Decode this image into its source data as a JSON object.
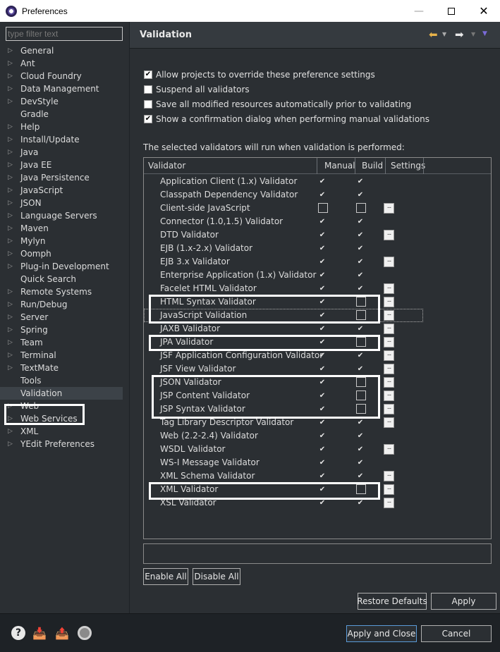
{
  "window": {
    "title": "Preferences"
  },
  "filter": {
    "placeholder": "type filter text"
  },
  "tree": [
    {
      "label": "General",
      "arrow": true
    },
    {
      "label": "Ant",
      "arrow": true
    },
    {
      "label": "Cloud Foundry",
      "arrow": true
    },
    {
      "label": "Data Management",
      "arrow": true
    },
    {
      "label": "DevStyle",
      "arrow": true
    },
    {
      "label": "Gradle",
      "arrow": false
    },
    {
      "label": "Help",
      "arrow": true
    },
    {
      "label": "Install/Update",
      "arrow": true
    },
    {
      "label": "Java",
      "arrow": true
    },
    {
      "label": "Java EE",
      "arrow": true
    },
    {
      "label": "Java Persistence",
      "arrow": true
    },
    {
      "label": "JavaScript",
      "arrow": true
    },
    {
      "label": "JSON",
      "arrow": true
    },
    {
      "label": "Language Servers",
      "arrow": true
    },
    {
      "label": "Maven",
      "arrow": true
    },
    {
      "label": "Mylyn",
      "arrow": true
    },
    {
      "label": "Oomph",
      "arrow": true
    },
    {
      "label": "Plug-in Development",
      "arrow": true
    },
    {
      "label": "Quick Search",
      "arrow": false
    },
    {
      "label": "Remote Systems",
      "arrow": true
    },
    {
      "label": "Run/Debug",
      "arrow": true
    },
    {
      "label": "Server",
      "arrow": true
    },
    {
      "label": "Spring",
      "arrow": true
    },
    {
      "label": "Team",
      "arrow": true
    },
    {
      "label": "Terminal",
      "arrow": true
    },
    {
      "label": "TextMate",
      "arrow": true
    },
    {
      "label": "Tools",
      "arrow": false
    },
    {
      "label": "Validation",
      "arrow": false,
      "selected": true
    },
    {
      "label": "Web",
      "arrow": true
    },
    {
      "label": "Web Services",
      "arrow": true
    },
    {
      "label": "XML",
      "arrow": true
    },
    {
      "label": "YEdit Preferences",
      "arrow": true
    }
  ],
  "page": {
    "title": "Validation"
  },
  "options": [
    {
      "label": "Allow projects to override these preference settings",
      "checked": true
    },
    {
      "label": "Suspend all validators",
      "checked": false
    },
    {
      "label": "Save all modified resources automatically prior to validating",
      "checked": false
    },
    {
      "label": "Show a confirmation dialog when performing manual validations",
      "checked": true
    }
  ],
  "description": "The selected validators will run when validation is performed:",
  "table": {
    "headers": [
      "Validator",
      "Manual",
      "Build",
      "Settings"
    ],
    "rows": [
      {
        "name": "Application Client (1.x) Validator",
        "manual": true,
        "build": true,
        "settings": false
      },
      {
        "name": "Classpath Dependency Validator",
        "manual": true,
        "build": true,
        "settings": false
      },
      {
        "name": "Client-side JavaScript",
        "manual": false,
        "build": false,
        "settings": true
      },
      {
        "name": "Connector (1.0,1.5) Validator",
        "manual": true,
        "build": true,
        "settings": false
      },
      {
        "name": "DTD Validator",
        "manual": true,
        "build": true,
        "settings": true
      },
      {
        "name": "EJB (1.x-2.x) Validator",
        "manual": true,
        "build": true,
        "settings": false
      },
      {
        "name": "EJB 3.x Validator",
        "manual": true,
        "build": true,
        "settings": true
      },
      {
        "name": "Enterprise Application (1.x) Validator",
        "manual": true,
        "build": true,
        "settings": false
      },
      {
        "name": "Facelet HTML Validator",
        "manual": true,
        "build": true,
        "settings": true
      },
      {
        "name": "HTML Syntax Validator",
        "manual": true,
        "build": false,
        "settings": true
      },
      {
        "name": "JavaScript Validation",
        "manual": true,
        "build": false,
        "settings": true,
        "focused": true
      },
      {
        "name": "JAXB Validator",
        "manual": true,
        "build": true,
        "settings": true
      },
      {
        "name": "JPA Validator",
        "manual": true,
        "build": false,
        "settings": true
      },
      {
        "name": "JSF Application Configuration Validator",
        "manual": true,
        "build": true,
        "settings": true
      },
      {
        "name": "JSF View Validator",
        "manual": true,
        "build": true,
        "settings": true
      },
      {
        "name": "JSON Validator",
        "manual": true,
        "build": false,
        "settings": true
      },
      {
        "name": "JSP Content Validator",
        "manual": true,
        "build": false,
        "settings": true
      },
      {
        "name": "JSP Syntax Validator",
        "manual": true,
        "build": false,
        "settings": true
      },
      {
        "name": "Tag Library Descriptor Validator",
        "manual": true,
        "build": true,
        "settings": true
      },
      {
        "name": "Web (2.2-2.4) Validator",
        "manual": true,
        "build": true,
        "settings": false
      },
      {
        "name": "WSDL Validator",
        "manual": true,
        "build": true,
        "settings": true
      },
      {
        "name": "WS-I Message Validator",
        "manual": true,
        "build": true,
        "settings": false
      },
      {
        "name": "XML Schema Validator",
        "manual": true,
        "build": true,
        "settings": true
      },
      {
        "name": "XML Validator",
        "manual": true,
        "build": false,
        "settings": true
      },
      {
        "name": "XSL Validator",
        "manual": true,
        "build": true,
        "settings": true
      }
    ]
  },
  "buttons": {
    "enable_all": "Enable All",
    "disable_all": "Disable All",
    "restore_defaults": "Restore Defaults",
    "apply": "Apply",
    "apply_and_close": "Apply and Close",
    "cancel": "Cancel"
  }
}
